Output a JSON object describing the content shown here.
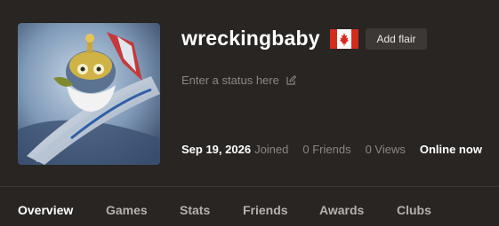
{
  "profile": {
    "username": "wreckingbaby",
    "flag_icon": "canada-flag-icon",
    "add_flair_label": "Add flair",
    "status_placeholder": "Enter a status here",
    "status_edit_icon": "edit-icon",
    "joined_date": "Sep 19, 2026",
    "joined_label": "Joined",
    "friends": "0 Friends",
    "views": "0 Views",
    "online_status": "Online now"
  },
  "tabs": [
    {
      "label": "Overview",
      "active": true
    },
    {
      "label": "Games",
      "active": false
    },
    {
      "label": "Stats",
      "active": false
    },
    {
      "label": "Friends",
      "active": false
    },
    {
      "label": "Awards",
      "active": false
    },
    {
      "label": "Clubs",
      "active": false
    }
  ],
  "colors": {
    "background": "#282522",
    "button_bg": "#3b3835",
    "muted_text": "#8b8884",
    "tab_text": "#b5b1ac",
    "flag_red": "#d52b1e"
  }
}
